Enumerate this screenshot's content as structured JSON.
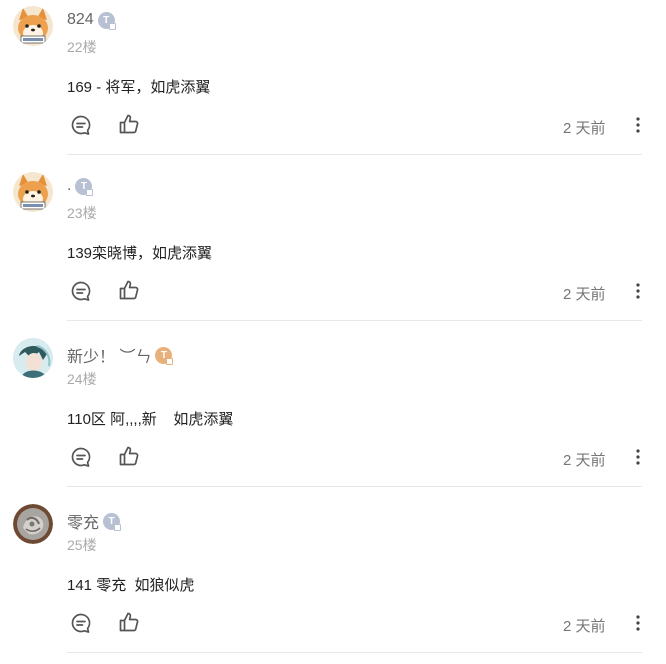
{
  "comments": [
    {
      "username": "824",
      "level": "T",
      "floor": "22楼",
      "content": "169 - 将军，如虎添翼",
      "time": "2 天前",
      "badge_color": "#b8c1d3",
      "avatar": "shiba-dog-avatar"
    },
    {
      "username": ".",
      "level": "T",
      "floor": "23楼",
      "content": "139栾晓博，如虎添翼",
      "time": "2 天前",
      "badge_color": "#b8c1d3",
      "avatar": "shiba-dog-avatar"
    },
    {
      "username": "新少！ ︶ㄣ",
      "level": "T",
      "floor": "24楼",
      "content": "110区 阿,,,,新    如虎添翼",
      "time": "2 天前",
      "badge_color": "#e8b07a",
      "avatar": "anime-character-avatar"
    },
    {
      "username": "零充",
      "level": "T",
      "floor": "25楼",
      "content": "141 零充  如狼似虎",
      "time": "2 天前",
      "badge_color": "#b8c1d3",
      "avatar": "stone-emblem-avatar"
    }
  ]
}
